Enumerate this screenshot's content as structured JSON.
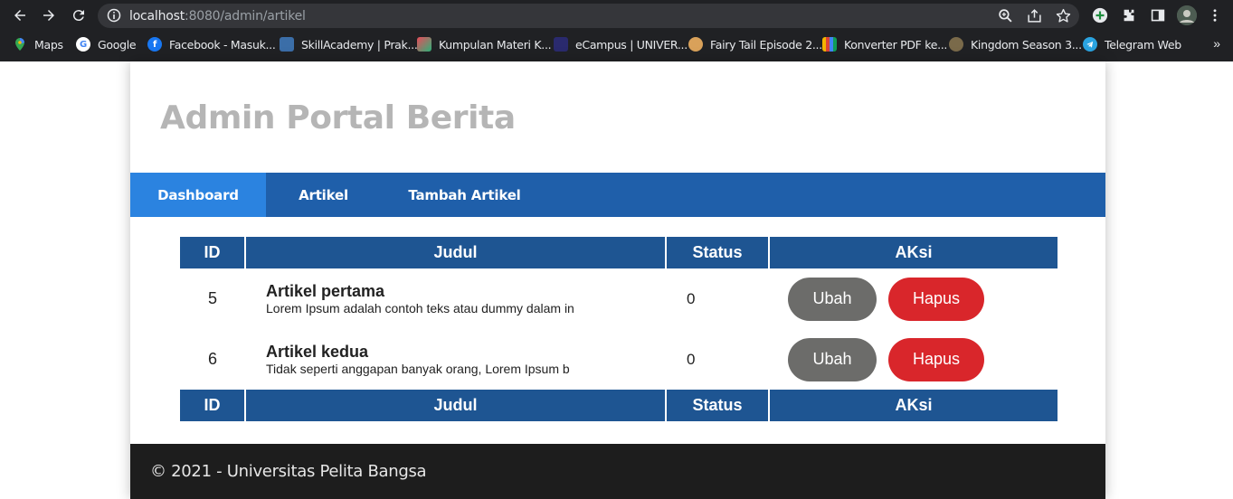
{
  "browser": {
    "url_host": "localhost",
    "url_rest": ":8080/admin/artikel",
    "bookmarks": [
      {
        "label": "Maps",
        "icon": "maps-icon"
      },
      {
        "label": "Google",
        "icon": "google-icon"
      },
      {
        "label": "Facebook - Masuk...",
        "icon": "facebook-icon"
      },
      {
        "label": "SkillAcademy | Prak...",
        "icon": "skillacademy-icon"
      },
      {
        "label": "Kumpulan Materi K...",
        "icon": "materi-icon"
      },
      {
        "label": "eCampus | UNIVER...",
        "icon": "ecampus-icon"
      },
      {
        "label": "Fairy Tail Episode 2...",
        "icon": "fairytail-icon"
      },
      {
        "label": "Konverter PDF ke...",
        "icon": "pdf-icon"
      },
      {
        "label": "Kingdom Season 3...",
        "icon": "kingdom-icon"
      },
      {
        "label": "Telegram Web",
        "icon": "telegram-icon"
      }
    ],
    "more_label": "»"
  },
  "site": {
    "title": "Admin Portal Berita"
  },
  "nav": {
    "items": [
      {
        "label": "Dashboard",
        "active": true
      },
      {
        "label": "Artikel",
        "active": false
      },
      {
        "label": "Tambah Artikel",
        "active": false
      }
    ]
  },
  "table": {
    "headers": [
      "ID",
      "Judul",
      "Status",
      "AKsi"
    ],
    "rows": [
      {
        "id": "5",
        "title": "Artikel pertama",
        "excerpt": "Lorem Ipsum adalah contoh teks atau dummy dalam in",
        "status": "0",
        "edit_label": "Ubah",
        "delete_label": "Hapus"
      },
      {
        "id": "6",
        "title": "Artikel kedua",
        "excerpt": "Tidak seperti anggapan banyak orang, Lorem Ipsum b",
        "status": "0",
        "edit_label": "Ubah",
        "delete_label": "Hapus"
      }
    ],
    "footer_headers": [
      "ID",
      "Judul",
      "Status",
      "AKsi"
    ]
  },
  "footer": {
    "text": "© 2021 - Universitas Pelita Bangsa"
  },
  "colors": {
    "chrome_bg": "#202124",
    "nav_bg": "#1f5faa",
    "nav_active": "#2b83e0",
    "table_header": "#1e5592",
    "btn_edit": "#6c6c6a",
    "btn_delete": "#d9262b",
    "footer_bg": "#1d1d1d"
  }
}
